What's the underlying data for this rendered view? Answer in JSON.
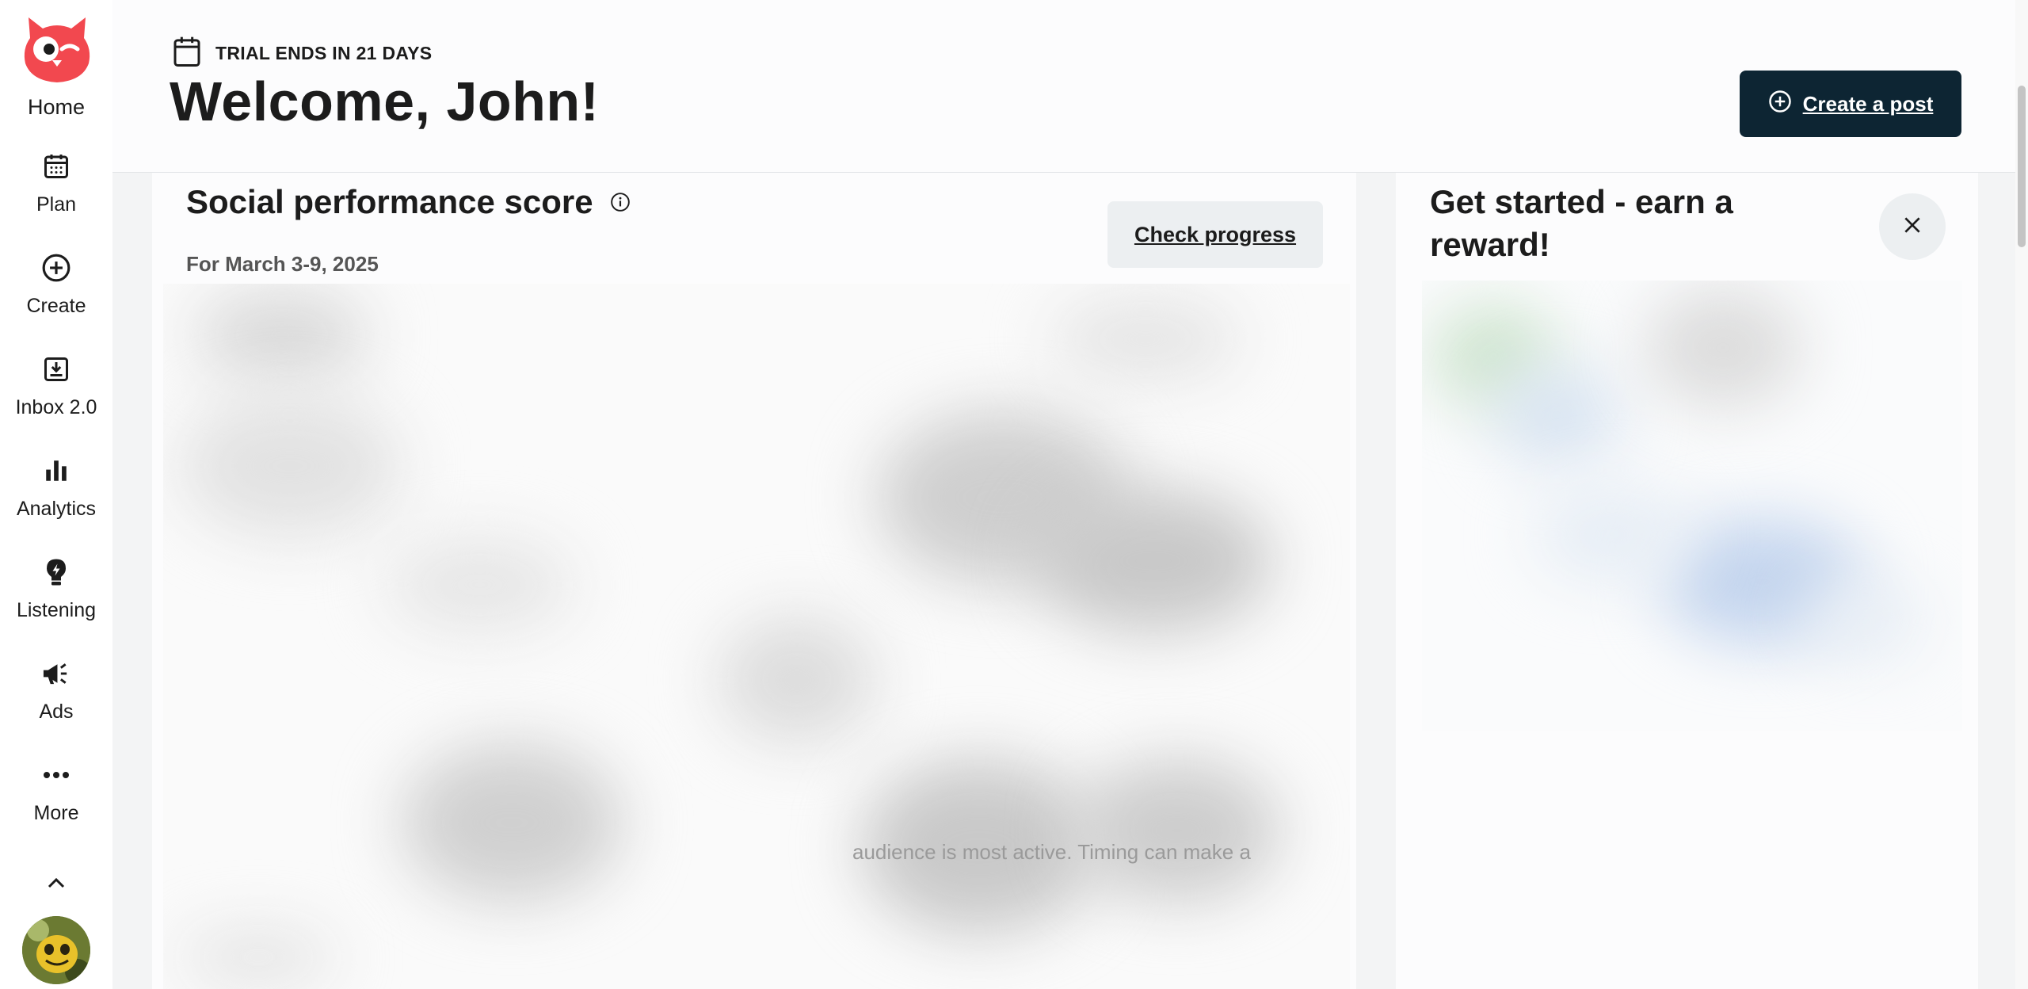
{
  "sidebar": {
    "home_label": "Home",
    "items": [
      {
        "label": "Plan",
        "icon": "calendar-icon"
      },
      {
        "label": "Create",
        "icon": "plus-circle-icon"
      },
      {
        "label": "Inbox 2.0",
        "icon": "inbox-icon"
      },
      {
        "label": "Analytics",
        "icon": "bar-chart-icon"
      },
      {
        "label": "Listening",
        "icon": "lightbulb-icon"
      },
      {
        "label": "Ads",
        "icon": "megaphone-icon"
      },
      {
        "label": "More",
        "icon": "more-dots-icon"
      }
    ]
  },
  "header": {
    "trial_text": "TRIAL ENDS IN 21 DAYS",
    "welcome": "Welcome, John!",
    "create_post_label": "Create a post"
  },
  "performance": {
    "title": "Social performance score",
    "date_range": "For March 3-9, 2025",
    "check_progress_label": "Check progress",
    "faded_text": "audience is most active. Timing can make a"
  },
  "reward": {
    "title": "Get started - earn a reward!"
  },
  "colors": {
    "brand_owl": "#f2484f",
    "primary_button": "#0d2533",
    "secondary_button": "#eceff1"
  }
}
